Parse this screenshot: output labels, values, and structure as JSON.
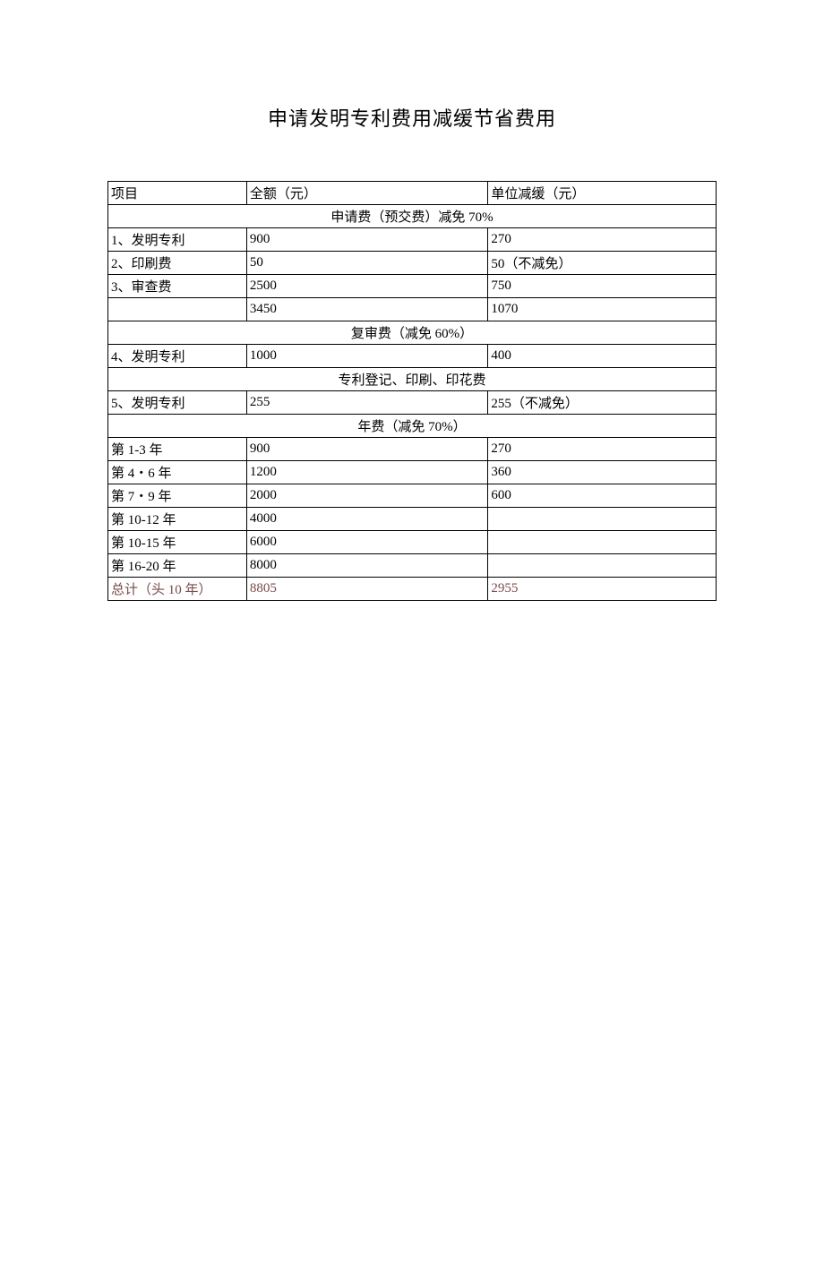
{
  "title": "申请发明专利费用减缓节省费用",
  "headers": {
    "item": "项目",
    "full": "全额（元）",
    "reduced": "单位减缓（元）"
  },
  "sections": {
    "s1": "申请费（预交费）减免 70%",
    "s2": "复审费（减免 60%）",
    "s3": "专利登记、印刷、印花费",
    "s4": "年费（减免 70%）"
  },
  "rows": {
    "r1": {
      "item": "1、发明专利",
      "full": "900",
      "reduced": "270"
    },
    "r2": {
      "item": "2、印刷费",
      "full": "50",
      "reduced": "50（不减免）"
    },
    "r3": {
      "item": "3、审查费",
      "full": "2500",
      "reduced": "750"
    },
    "r4": {
      "item": "",
      "full": "3450",
      "reduced": "1070"
    },
    "r5": {
      "item": "4、发明专利",
      "full": "1000",
      "reduced": "400"
    },
    "r6": {
      "item": "5、发明专利",
      "full": "255",
      "reduced": "255（不减免）"
    },
    "r7": {
      "item": "第 1-3 年",
      "full": "900",
      "reduced": "270"
    },
    "r8": {
      "item": "第 4・6 年",
      "full": "1200",
      "reduced": "360"
    },
    "r9": {
      "item": "第 7・9 年",
      "full": "2000",
      "reduced": "600"
    },
    "r10": {
      "item": "第 10-12 年",
      "full": "4000",
      "reduced": ""
    },
    "r11": {
      "item": "第 10-15 年",
      "full": "6000",
      "reduced": ""
    },
    "r12": {
      "item": "第 16-20 年",
      "full": "8000",
      "reduced": ""
    },
    "r13": {
      "item": "总计（头 10 年）",
      "full": "8805",
      "reduced": "2955"
    }
  }
}
